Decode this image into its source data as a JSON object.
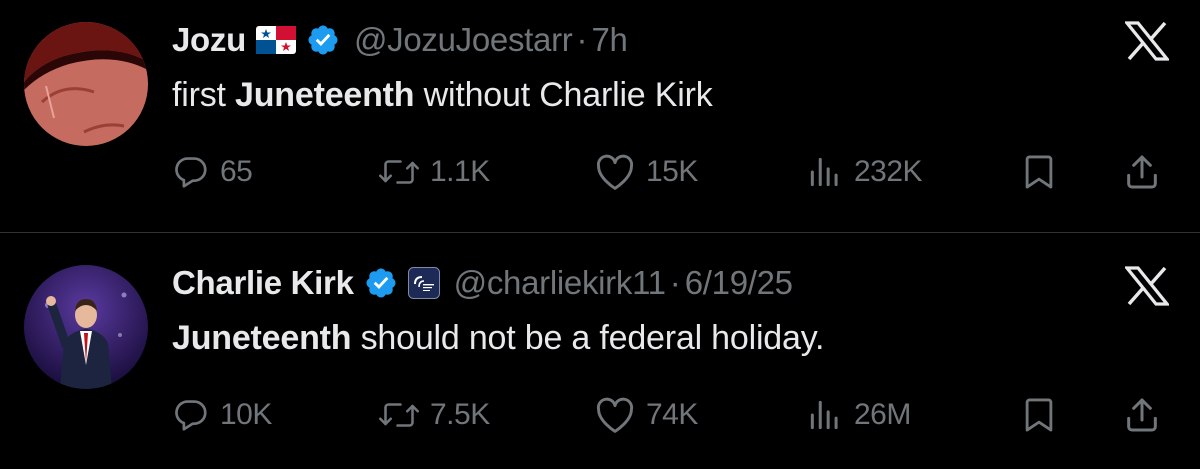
{
  "tweets": [
    {
      "display_name": "Jozu",
      "flag_icon": "panama-flag-icon",
      "verified_icon": "verified-badge-icon",
      "handle": "@JozuJoestarr",
      "separator": "·",
      "time": "7h",
      "text_parts": {
        "pre": "first ",
        "bold": "Juneteenth",
        "post": " without Charlie Kirk"
      },
      "stats": {
        "replies": "65",
        "reposts": "1.1K",
        "likes": "15K",
        "views": "232K"
      }
    },
    {
      "display_name": "Charlie Kirk",
      "verified_icon": "verified-badge-icon",
      "org_badge_icon": "turning-point-usa-affiliate-icon",
      "handle": "@charliekirk11",
      "separator": "·",
      "time": "6/19/25",
      "text_parts": {
        "pre": "",
        "bold": "Juneteenth",
        "post": " should not be a federal holiday."
      },
      "stats": {
        "replies": "10K",
        "reposts": "7.5K",
        "likes": "74K",
        "views": "26M"
      }
    }
  ],
  "colors": {
    "background": "#000000",
    "text_primary": "#e7e9ea",
    "text_secondary": "#71767b",
    "verified_blue": "#1d9bf0",
    "divider": "#2f3336"
  },
  "platform_icon": "x-logo-icon"
}
